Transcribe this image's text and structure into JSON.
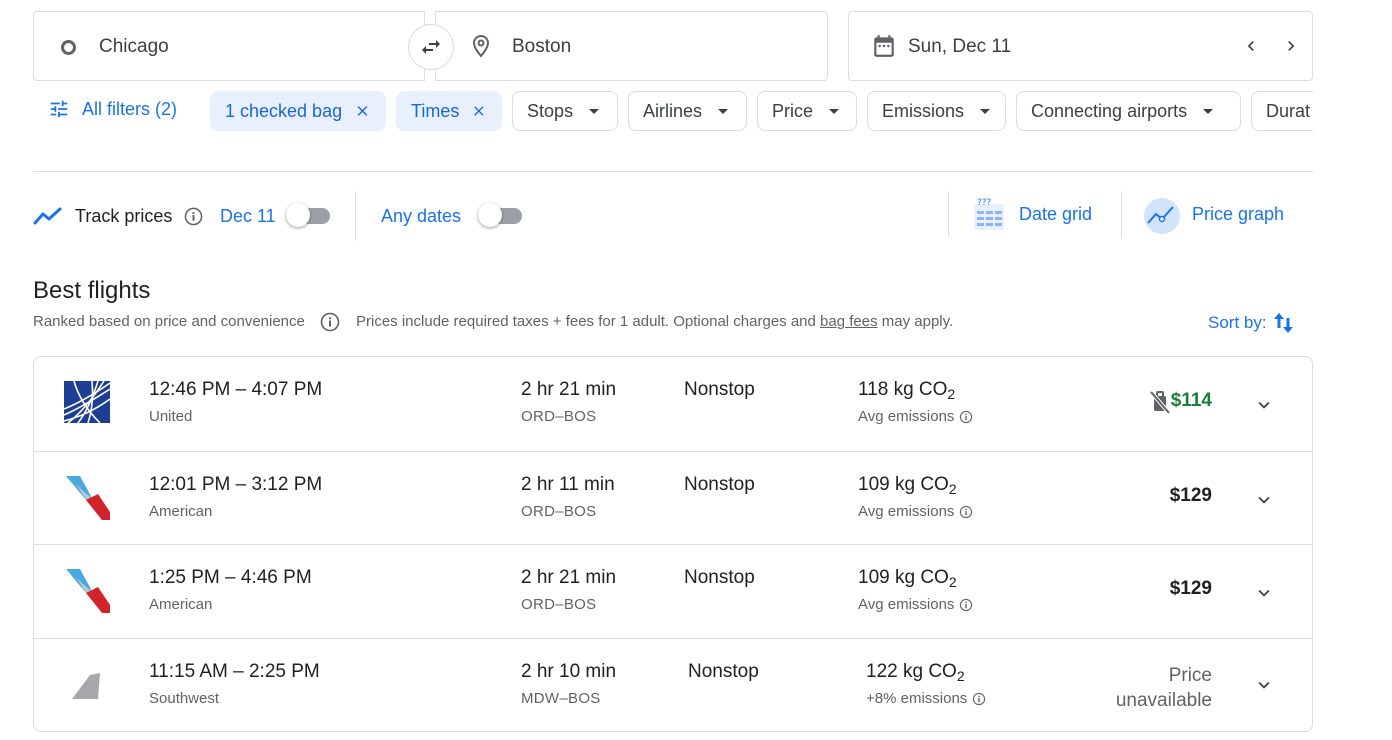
{
  "search": {
    "origin": "Chicago",
    "destination": "Boston",
    "date": "Sun, Dec 11"
  },
  "filters": {
    "all_filters": "All filters (2)",
    "chips": [
      {
        "label": "1 checked bag",
        "active": true
      },
      {
        "label": "Times",
        "active": true
      },
      {
        "label": "Stops",
        "active": false
      },
      {
        "label": "Airlines",
        "active": false
      },
      {
        "label": "Price",
        "active": false
      },
      {
        "label": "Emissions",
        "active": false
      },
      {
        "label": "Connecting airports",
        "active": false
      },
      {
        "label": "Durat",
        "active": false
      }
    ]
  },
  "tracking": {
    "track_prices": "Track prices",
    "date_label": "Dec 11",
    "any_dates": "Any dates",
    "date_grid": "Date grid",
    "price_graph": "Price graph"
  },
  "results": {
    "title": "Best flights",
    "ranked": "Ranked based on price and convenience",
    "prices_note_prefix": "Prices include required taxes + fees for 1 adult. Optional charges and",
    "bag_fees": "bag fees",
    "prices_note_suffix": "may apply.",
    "sort_by": "Sort by:"
  },
  "flights": [
    {
      "times": "12:46 PM – 4:07 PM",
      "airline": "United",
      "duration": "2 hr 21 min",
      "route": "ORD–BOS",
      "stops": "Nonstop",
      "co2_value": "118 kg CO",
      "co2_sub": "2",
      "emissions": "Avg emissions",
      "price": "$114",
      "price_color": "#188038",
      "logo": "united-globe"
    },
    {
      "times": "12:01 PM – 3:12 PM",
      "airline": "American",
      "duration": "2 hr 11 min",
      "route": "ORD–BOS",
      "stops": "Nonstop",
      "co2_value": "109 kg CO",
      "co2_sub": "2",
      "emissions": "Avg emissions",
      "price": "$129",
      "logo": "american-tail"
    },
    {
      "times": "1:25 PM – 4:46 PM",
      "airline": "American",
      "duration": "2 hr 21 min",
      "route": "ORD–BOS",
      "stops": "Nonstop",
      "co2_value": "109 kg CO",
      "co2_sub": "2",
      "emissions": "Avg emissions",
      "price": "$129",
      "logo": "american-tail"
    },
    {
      "times": "11:15 AM – 2:25 PM",
      "airline": "Southwest",
      "duration": "2 hr 10 min",
      "route": "MDW–BOS",
      "stops": "Nonstop",
      "co2_value": "122 kg CO",
      "co2_sub": "2",
      "emissions": "+8% emissions",
      "price_line1": "Price",
      "price_line2": "unavailable",
      "logo": "southwest-tail"
    }
  ]
}
